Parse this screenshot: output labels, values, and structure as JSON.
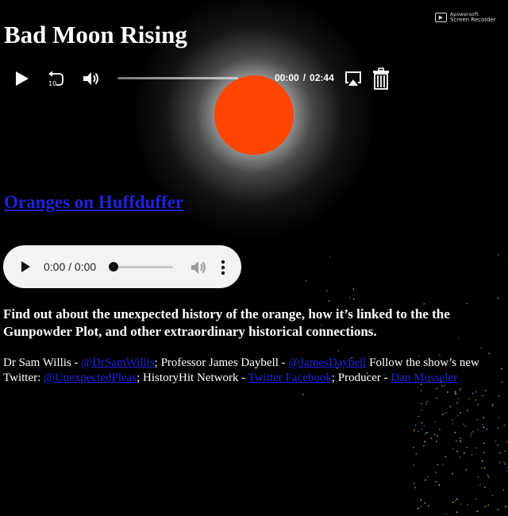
{
  "recorder_badge": {
    "logo": "rec",
    "line1": "Apowersoft",
    "line2": "Screen Recorder"
  },
  "page": {
    "title": "Bad Moon Rising"
  },
  "player": {
    "play_icon": "play-icon",
    "rewind_icon": "rewind-10-icon",
    "rewind_label": "10",
    "volume_icon": "volume-icon",
    "current_time": "00:00",
    "time_separator": "/",
    "duration": "02:44",
    "airplay_icon": "airplay-icon",
    "trash_icon": "trash-icon",
    "progress": 0
  },
  "link": {
    "text": "Oranges on Huffduffer"
  },
  "audio": {
    "time": "0:00 / 0:00",
    "play_icon": "play-icon",
    "volume_icon": "volume-icon",
    "more_icon": "more-vertical-icon"
  },
  "description": "Find out about the unexpected history of the orange, how it’s linked to the the Gunpowder Plot, and other extraordinary historical connections.",
  "credits": {
    "part1": "Dr Sam Willis - ",
    "link1": "@DrSamWillis",
    "part2": "; Professor James Daybell - ",
    "link2": "@JamesDaybell",
    "part3": " Follow the show’s new Twitter: ",
    "link3": "@UnexpectedPleas",
    "part4": "; HistoryHit Network - ",
    "link4": "Twitter Facebook",
    "part5": "; Producer - ",
    "link5": "Dan Mosseler"
  },
  "colors": {
    "background": "#000000",
    "sun": "#ff4500",
    "link": "#2222dd",
    "pill": "#f1f3f4"
  }
}
